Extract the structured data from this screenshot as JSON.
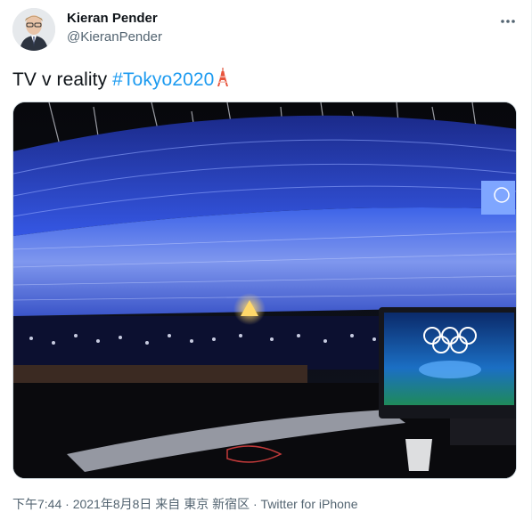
{
  "author": {
    "name": "Kieran Pender",
    "handle": "@KieranPender"
  },
  "tweet": {
    "text_before": "TV v reality ",
    "hashtag": "#Tokyo2020",
    "emoji": "tokyo-tower-emoji"
  },
  "media": {
    "description_icon": "stadium-photo",
    "tv_screen_icon": "olympic-rings-broadcast"
  },
  "meta": {
    "time": "下午7:44",
    "separator1": " · ",
    "date": "2021年8月8日 来自 東京 新宿区",
    "separator2": " · ",
    "source": "Twitter for iPhone"
  },
  "colors": {
    "accent": "#1d9bf0",
    "text": "#0f1419",
    "secondary": "#536471",
    "stadium_blue": "#2b4fd8"
  },
  "icons": {
    "more": "more-dots-icon"
  }
}
